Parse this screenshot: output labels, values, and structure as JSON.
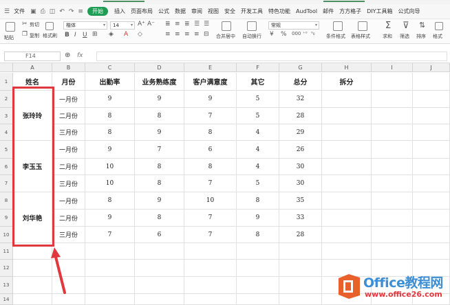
{
  "menu": {
    "file": "文件",
    "items": [
      "开始",
      "插入",
      "页面布局",
      "公式",
      "数据",
      "审阅",
      "视图",
      "安全",
      "开发工具",
      "特色功能",
      "AudTool",
      "邮件",
      "方方格子",
      "DIY工具箱",
      "公式向导"
    ],
    "active_index": 0
  },
  "ribbon": {
    "cut": "剪切",
    "paste": "粘贴",
    "copy": "复制",
    "format_painter": "格式刷",
    "font_name": "楷体",
    "font_size": "14",
    "merge_center": "合并居中",
    "wrap": "自动换行",
    "number_format": "常规",
    "cond_format": "条件格式",
    "table_style": "表格样式",
    "sum": "求和",
    "filter": "筛选",
    "sort": "排序",
    "format": "格式"
  },
  "formula_bar": {
    "cell_ref": "F14",
    "fx": "fx",
    "value": ""
  },
  "columns": [
    "A",
    "B",
    "C",
    "D",
    "E",
    "F",
    "G",
    "H",
    "I",
    "J"
  ],
  "rows": [
    "1",
    "2",
    "3",
    "4",
    "5",
    "6",
    "7",
    "8",
    "9",
    "10",
    "11",
    "12",
    "13",
    "14"
  ],
  "table": {
    "headers": [
      "姓名",
      "月份",
      "出勤率",
      "业务熟练度",
      "客户满意度",
      "其它",
      "总分",
      "拆分"
    ],
    "names": [
      "张玲玲",
      "李玉玉",
      "刘华艳"
    ],
    "data": [
      [
        "一月份",
        "9",
        "9",
        "9",
        "5",
        "32"
      ],
      [
        "二月份",
        "8",
        "8",
        "7",
        "5",
        "28"
      ],
      [
        "三月份",
        "8",
        "9",
        "8",
        "4",
        "29"
      ],
      [
        "一月份",
        "9",
        "7",
        "6",
        "4",
        "26"
      ],
      [
        "二月份",
        "10",
        "8",
        "8",
        "4",
        "30"
      ],
      [
        "三月份",
        "10",
        "8",
        "7",
        "5",
        "30"
      ],
      [
        "一月份",
        "8",
        "9",
        "10",
        "8",
        "35"
      ],
      [
        "二月份",
        "9",
        "8",
        "7",
        "9",
        "33"
      ],
      [
        "三月份",
        "7",
        "6",
        "7",
        "8",
        "28"
      ]
    ]
  },
  "watermark": {
    "brand": "Office教程网",
    "url": "www.office26.com"
  },
  "colors": {
    "accent_green": "#1f9d55",
    "highlight_red": "#e0383e",
    "logo_blue": "#3c8fd6",
    "logo_orange": "#e8602c"
  }
}
